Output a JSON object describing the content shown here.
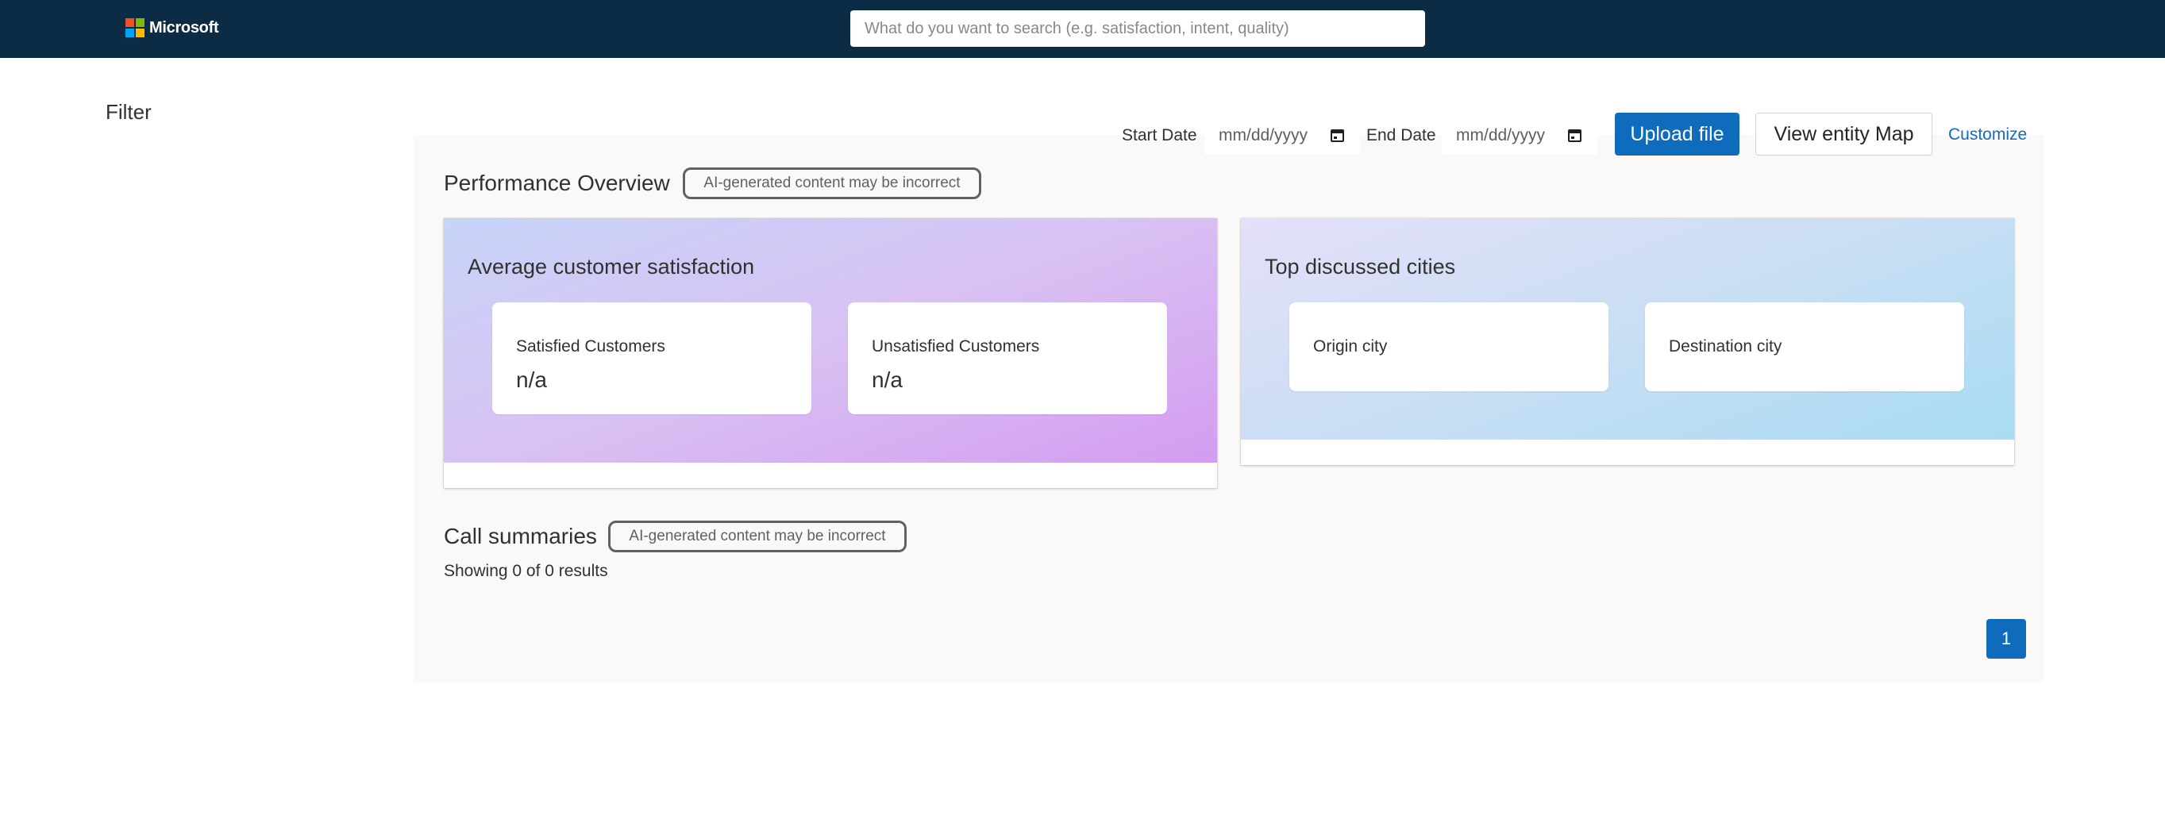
{
  "header": {
    "brand": "Microsoft",
    "logo_colors": [
      "#f25022",
      "#7fba00",
      "#00a4ef",
      "#ffb900"
    ],
    "search_placeholder": "What do you want to search (e.g. satisfaction, intent, quality)",
    "search_value": ""
  },
  "sidebar": {
    "title": "Filter"
  },
  "toolbar": {
    "start_label": "Start Date",
    "start_value": "mm/dd/yyyy",
    "end_label": "End Date",
    "end_value": "mm/dd/yyyy",
    "upload_label": "Upload file",
    "entity_map_label": "View entity Map",
    "customize_label": "Customize"
  },
  "performance": {
    "title": "Performance Overview",
    "ai_badge": "AI-generated content may be incorrect",
    "satisfaction_card": {
      "title": "Average customer satisfaction",
      "satisfied_label": "Satisfied Customers",
      "satisfied_value": "n/a",
      "unsatisfied_label": "Unsatisfied Customers",
      "unsatisfied_value": "n/a",
      "gradient": [
        "#c7d4f8",
        "#d49cf0"
      ]
    },
    "cities_card": {
      "title": "Top discussed cities",
      "origin_label": "Origin city",
      "destination_label": "Destination city",
      "gradient": [
        "#e4e0f8",
        "#a8dcf2"
      ]
    }
  },
  "summaries": {
    "title": "Call summaries",
    "ai_badge": "AI-generated content may be incorrect",
    "results_text": "Showing 0 of 0 results",
    "pagination": {
      "current_page": "1"
    }
  },
  "colors": {
    "topbar": "#0c2b45",
    "primary": "#0f6cbd",
    "panel": "#faf9f8"
  }
}
